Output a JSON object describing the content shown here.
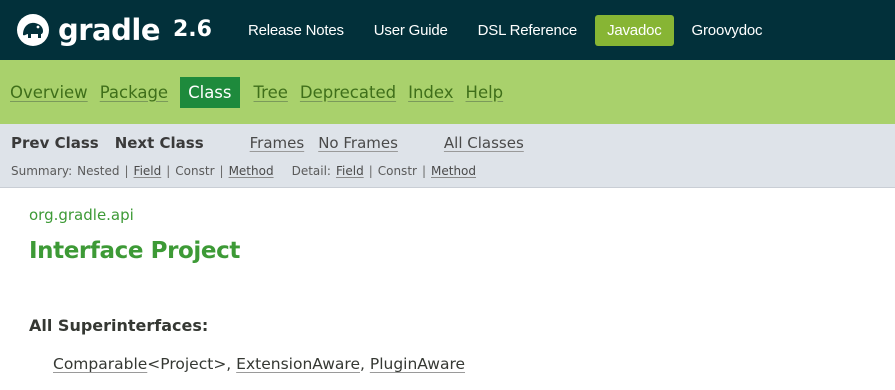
{
  "header": {
    "brand": "gradle",
    "version": "2.6",
    "nav": [
      {
        "label": "Release Notes",
        "active": false
      },
      {
        "label": "User Guide",
        "active": false
      },
      {
        "label": "DSL Reference",
        "active": false
      },
      {
        "label": "Javadoc",
        "active": true
      },
      {
        "label": "Groovydoc",
        "active": false
      }
    ],
    "colors": {
      "background": "#02303a",
      "active": "#87b534"
    }
  },
  "navbar": {
    "items": [
      "Overview",
      "Package",
      "Class",
      "Tree",
      "Deprecated",
      "Index",
      "Help"
    ],
    "active_item": "Class",
    "colors": {
      "background": "#a9d16c",
      "active": "#1e8a3c"
    }
  },
  "subnav": {
    "prev_class": "Prev Class",
    "next_class": "Next Class",
    "frames": "Frames",
    "no_frames": "No Frames",
    "all_classes": "All Classes",
    "summary_label": "Summary:",
    "summary_items": [
      "Nested",
      "Field",
      "Constr",
      "Method"
    ],
    "detail_label": "Detail:",
    "detail_items": [
      "Field",
      "Constr",
      "Method"
    ],
    "separator": "|"
  },
  "content": {
    "package": "org.gradle.api",
    "title": "Interface Project",
    "superinterfaces_header": "All Superinterfaces:",
    "superinterfaces": [
      "Comparable",
      "<Project>, ",
      "ExtensionAware",
      ", ",
      "PluginAware"
    ]
  },
  "icons": {
    "logo": "gradle-elephant-logo-icon"
  }
}
